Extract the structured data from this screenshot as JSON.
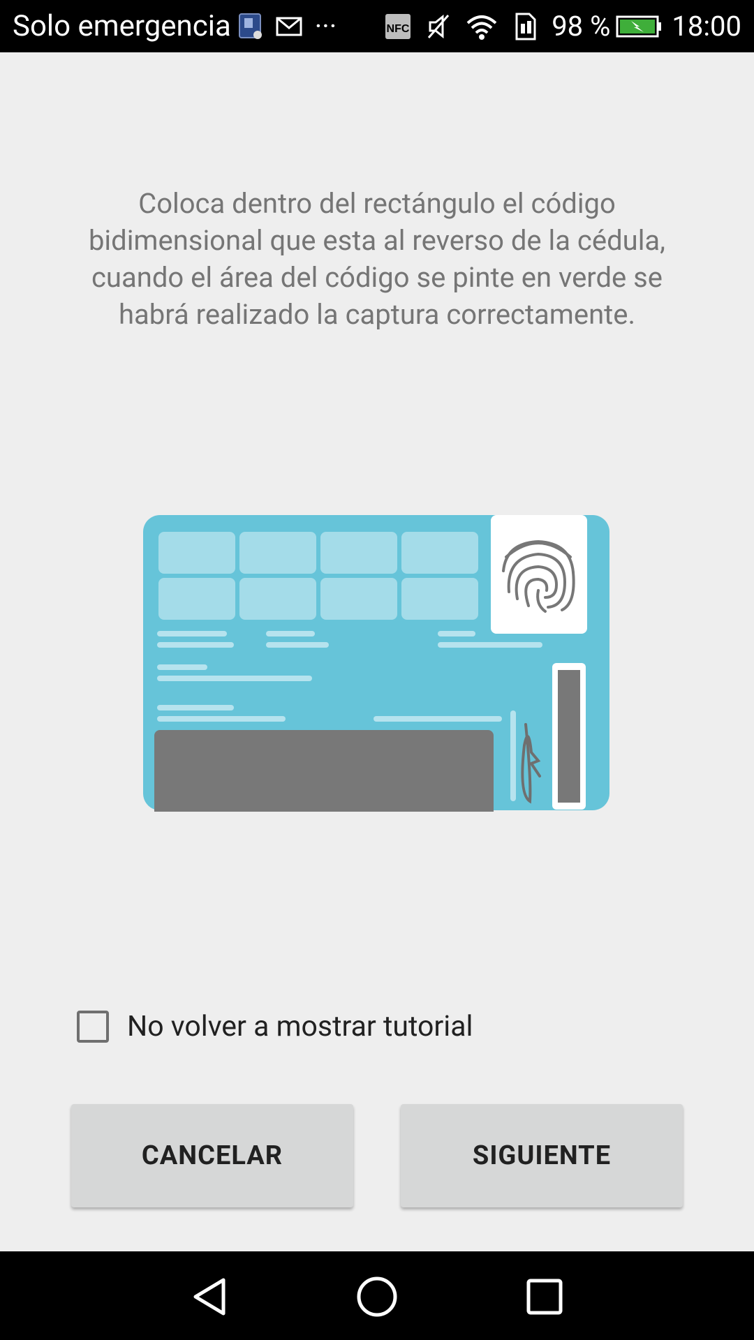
{
  "status_bar": {
    "carrier": "Solo emergencia",
    "overflow": "···",
    "battery_percent": "98 %",
    "time": "18:00",
    "icons": [
      "sim-alert-icon",
      "mail-icon",
      "more-icon",
      "nfc-icon",
      "vibrate-off-icon",
      "wifi-icon",
      "data-icon",
      "battery-charging-icon"
    ]
  },
  "instruction": "Coloca dentro del rectángulo el código bidimensional que esta al reverso de la cédula, cuando el área del código se pinte en verde se habrá realizado la captura correctamente.",
  "illustration": {
    "card_color": "#66c4d9",
    "barcode_color": "#787878"
  },
  "checkbox": {
    "label": "No volver a mostrar tutorial",
    "checked": false
  },
  "buttons": {
    "cancel": "CANCELAR",
    "next": "SIGUIENTE"
  },
  "nav_bar": {
    "icons": [
      "back-icon",
      "home-icon",
      "recents-icon"
    ]
  }
}
